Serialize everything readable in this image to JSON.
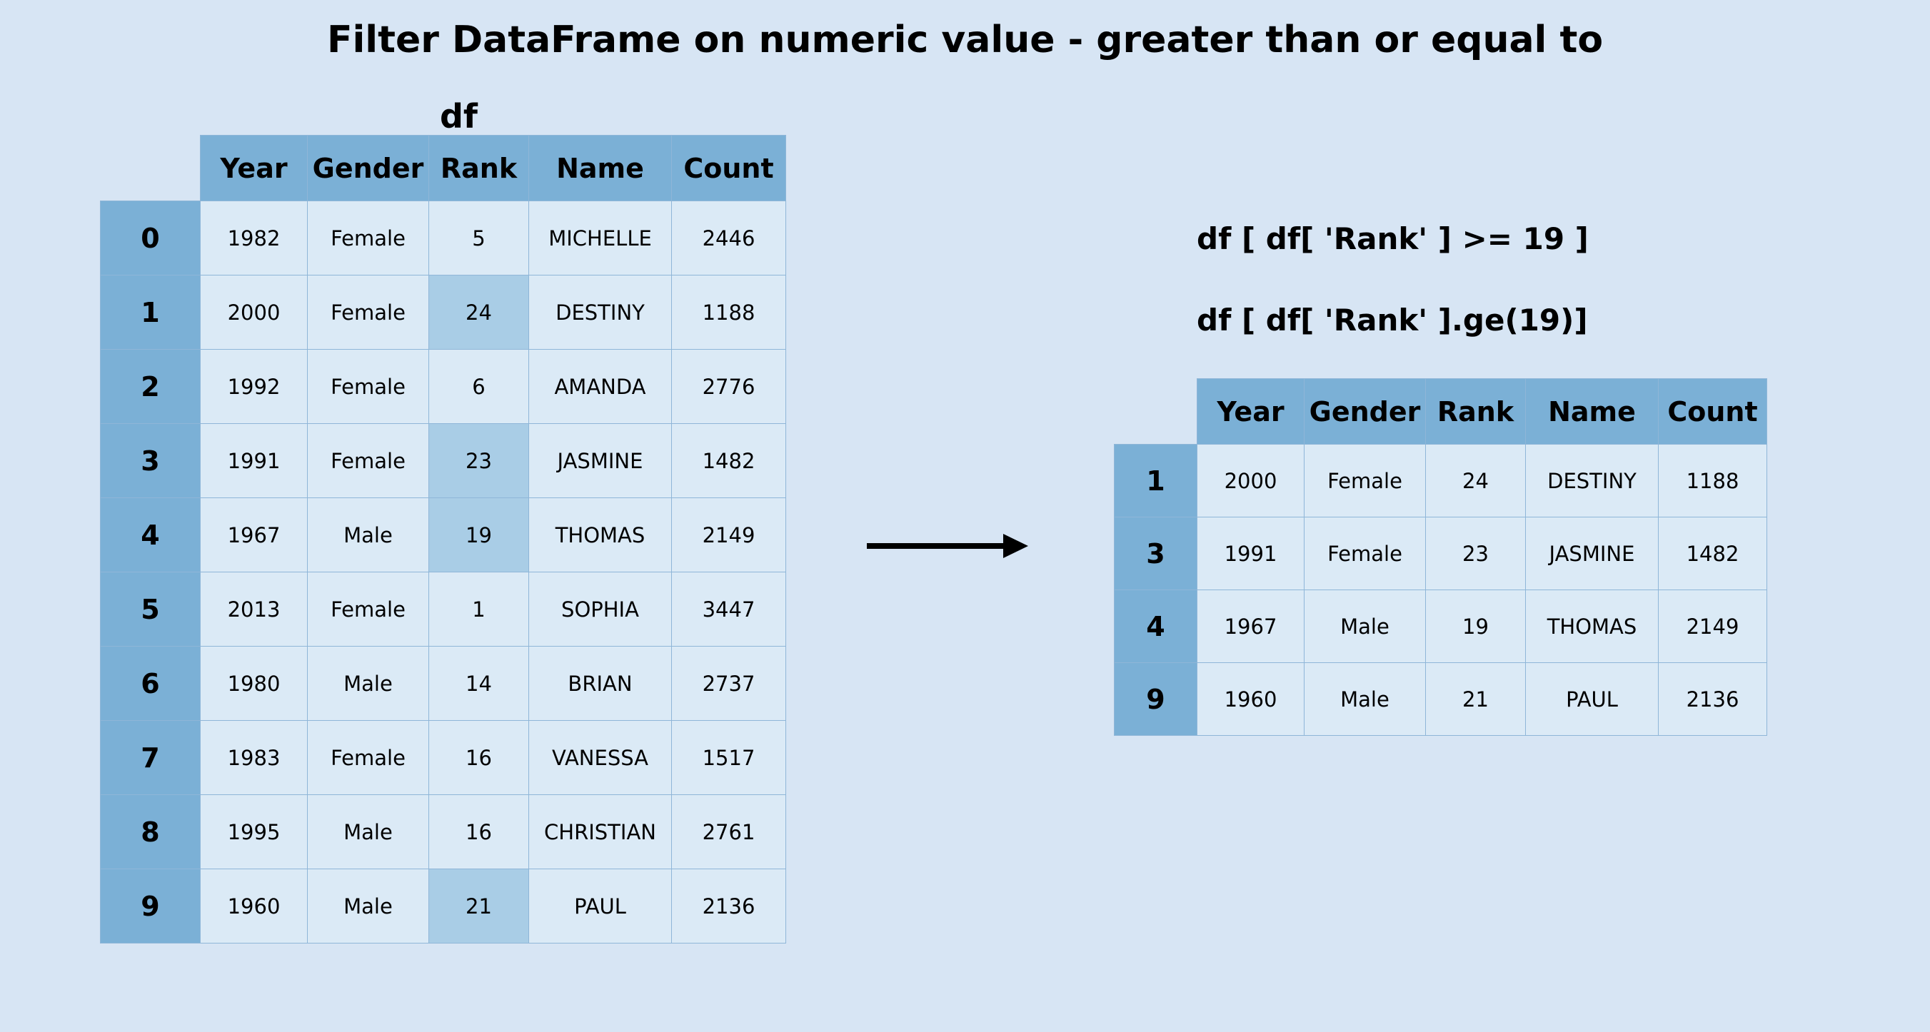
{
  "title": "Filter DataFrame on numeric value - greater than or equal to",
  "left": {
    "caption": "df",
    "columns": [
      "Year",
      "Gender",
      "Rank",
      "Name",
      "Count"
    ],
    "rows": [
      {
        "idx": "0",
        "year": "1982",
        "gender": "Female",
        "rank": "5",
        "name": "MICHELLE",
        "count": "2446",
        "hl": false
      },
      {
        "idx": "1",
        "year": "2000",
        "gender": "Female",
        "rank": "24",
        "name": "DESTINY",
        "count": "1188",
        "hl": true
      },
      {
        "idx": "2",
        "year": "1992",
        "gender": "Female",
        "rank": "6",
        "name": "AMANDA",
        "count": "2776",
        "hl": false
      },
      {
        "idx": "3",
        "year": "1991",
        "gender": "Female",
        "rank": "23",
        "name": "JASMINE",
        "count": "1482",
        "hl": true
      },
      {
        "idx": "4",
        "year": "1967",
        "gender": "Male",
        "rank": "19",
        "name": "THOMAS",
        "count": "2149",
        "hl": true
      },
      {
        "idx": "5",
        "year": "2013",
        "gender": "Female",
        "rank": "1",
        "name": "SOPHIA",
        "count": "3447",
        "hl": false
      },
      {
        "idx": "6",
        "year": "1980",
        "gender": "Male",
        "rank": "14",
        "name": "BRIAN",
        "count": "2737",
        "hl": false
      },
      {
        "idx": "7",
        "year": "1983",
        "gender": "Female",
        "rank": "16",
        "name": "VANESSA",
        "count": "1517",
        "hl": false
      },
      {
        "idx": "8",
        "year": "1995",
        "gender": "Male",
        "rank": "16",
        "name": "CHRISTIAN",
        "count": "2761",
        "hl": false
      },
      {
        "idx": "9",
        "year": "1960",
        "gender": "Male",
        "rank": "21",
        "name": "PAUL",
        "count": "2136",
        "hl": true
      }
    ]
  },
  "code": {
    "line1": "df [ df[ 'Rank' ] >= 19 ]",
    "line2": "df [ df[ 'Rank' ].ge(19)]"
  },
  "right": {
    "columns": [
      "Year",
      "Gender",
      "Rank",
      "Name",
      "Count"
    ],
    "rows": [
      {
        "idx": "1",
        "year": "2000",
        "gender": "Female",
        "rank": "24",
        "name": "DESTINY",
        "count": "1188"
      },
      {
        "idx": "3",
        "year": "1991",
        "gender": "Female",
        "rank": "23",
        "name": "JASMINE",
        "count": "1482"
      },
      {
        "idx": "4",
        "year": "1967",
        "gender": "Male",
        "rank": "19",
        "name": "THOMAS",
        "count": "2149"
      },
      {
        "idx": "9",
        "year": "1960",
        "gender": "Male",
        "rank": "21",
        "name": "PAUL",
        "count": "2136"
      }
    ]
  }
}
